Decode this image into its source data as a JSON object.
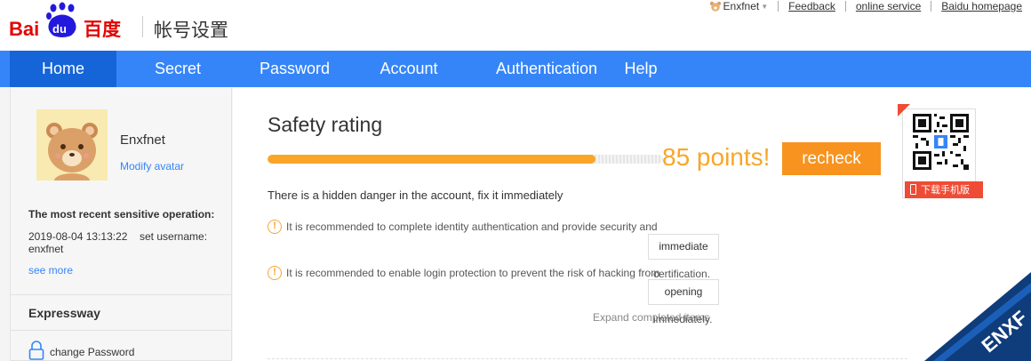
{
  "header": {
    "logo_cn": "帐号设置",
    "user_name": "Enxfnet",
    "links": [
      "Feedback",
      "online service",
      "Baidu homepage"
    ]
  },
  "nav": {
    "items": [
      "Home",
      "Secret",
      "Password",
      "Account",
      "Authentication",
      "Help"
    ],
    "active": "Home"
  },
  "sidebar": {
    "username": "Enxfnet",
    "modify_avatar": "Modify avatar",
    "recent_title": "The most recent sensitive operation:",
    "recent_date": "2019-08-04 13:13:22",
    "recent_action": "set username:",
    "recent_action_value": "enxfnet",
    "see_more": "see more",
    "expressway_title": "Expressway",
    "change_password": "change Password"
  },
  "main": {
    "title": "Safety rating",
    "score_fraction": 0.83,
    "points": "85 points!",
    "recheck": "recheck",
    "danger_text": "There is a hidden danger in the account, fix it immediately",
    "warnings": [
      {
        "text": "It is recommended to complete identity authentication and provide security and",
        "button": "immediate",
        "tail": "certification."
      },
      {
        "text": "It is recommended to enable login protection to prevent the risk of hacking from",
        "button": "opening",
        "tail": "immediately."
      }
    ],
    "expand": "Expand completed items",
    "qr_badge": "下载手机版"
  },
  "colors": {
    "nav_blue": "#3585f9",
    "nav_active": "#1565d8",
    "orange": "#f9a628",
    "recheck": "#f7931e"
  }
}
